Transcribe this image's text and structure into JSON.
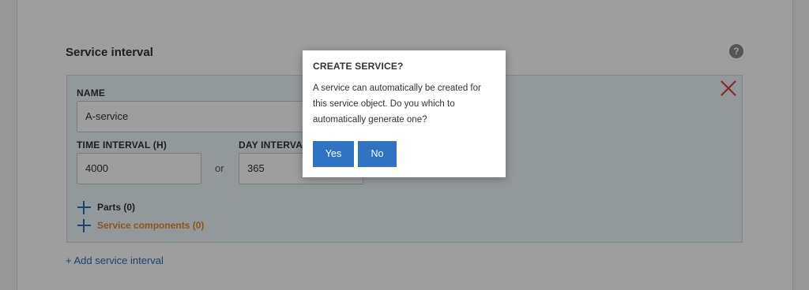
{
  "section": {
    "title": "Service interval",
    "help_icon_glyph": "?"
  },
  "interval": {
    "name_label": "NAME",
    "name_value": "A-service",
    "time_label": "TIME INTERVAL (H)",
    "time_value": "4000",
    "or_text": "or",
    "day_label": "DAY INTERVAL",
    "day_value": "365",
    "parts_label": "Parts (0)",
    "components_label": "Service components (0)"
  },
  "add_link": "+ Add service interval",
  "modal": {
    "title": "CREATE SERVICE?",
    "body": "A service can automatically be created for this service object. Do you which to automatically generate one?",
    "yes_label": "Yes",
    "no_label": "No"
  },
  "colors": {
    "primary": "#2f74c4",
    "close_red": "#d9413a",
    "orange": "#e08a2c"
  }
}
